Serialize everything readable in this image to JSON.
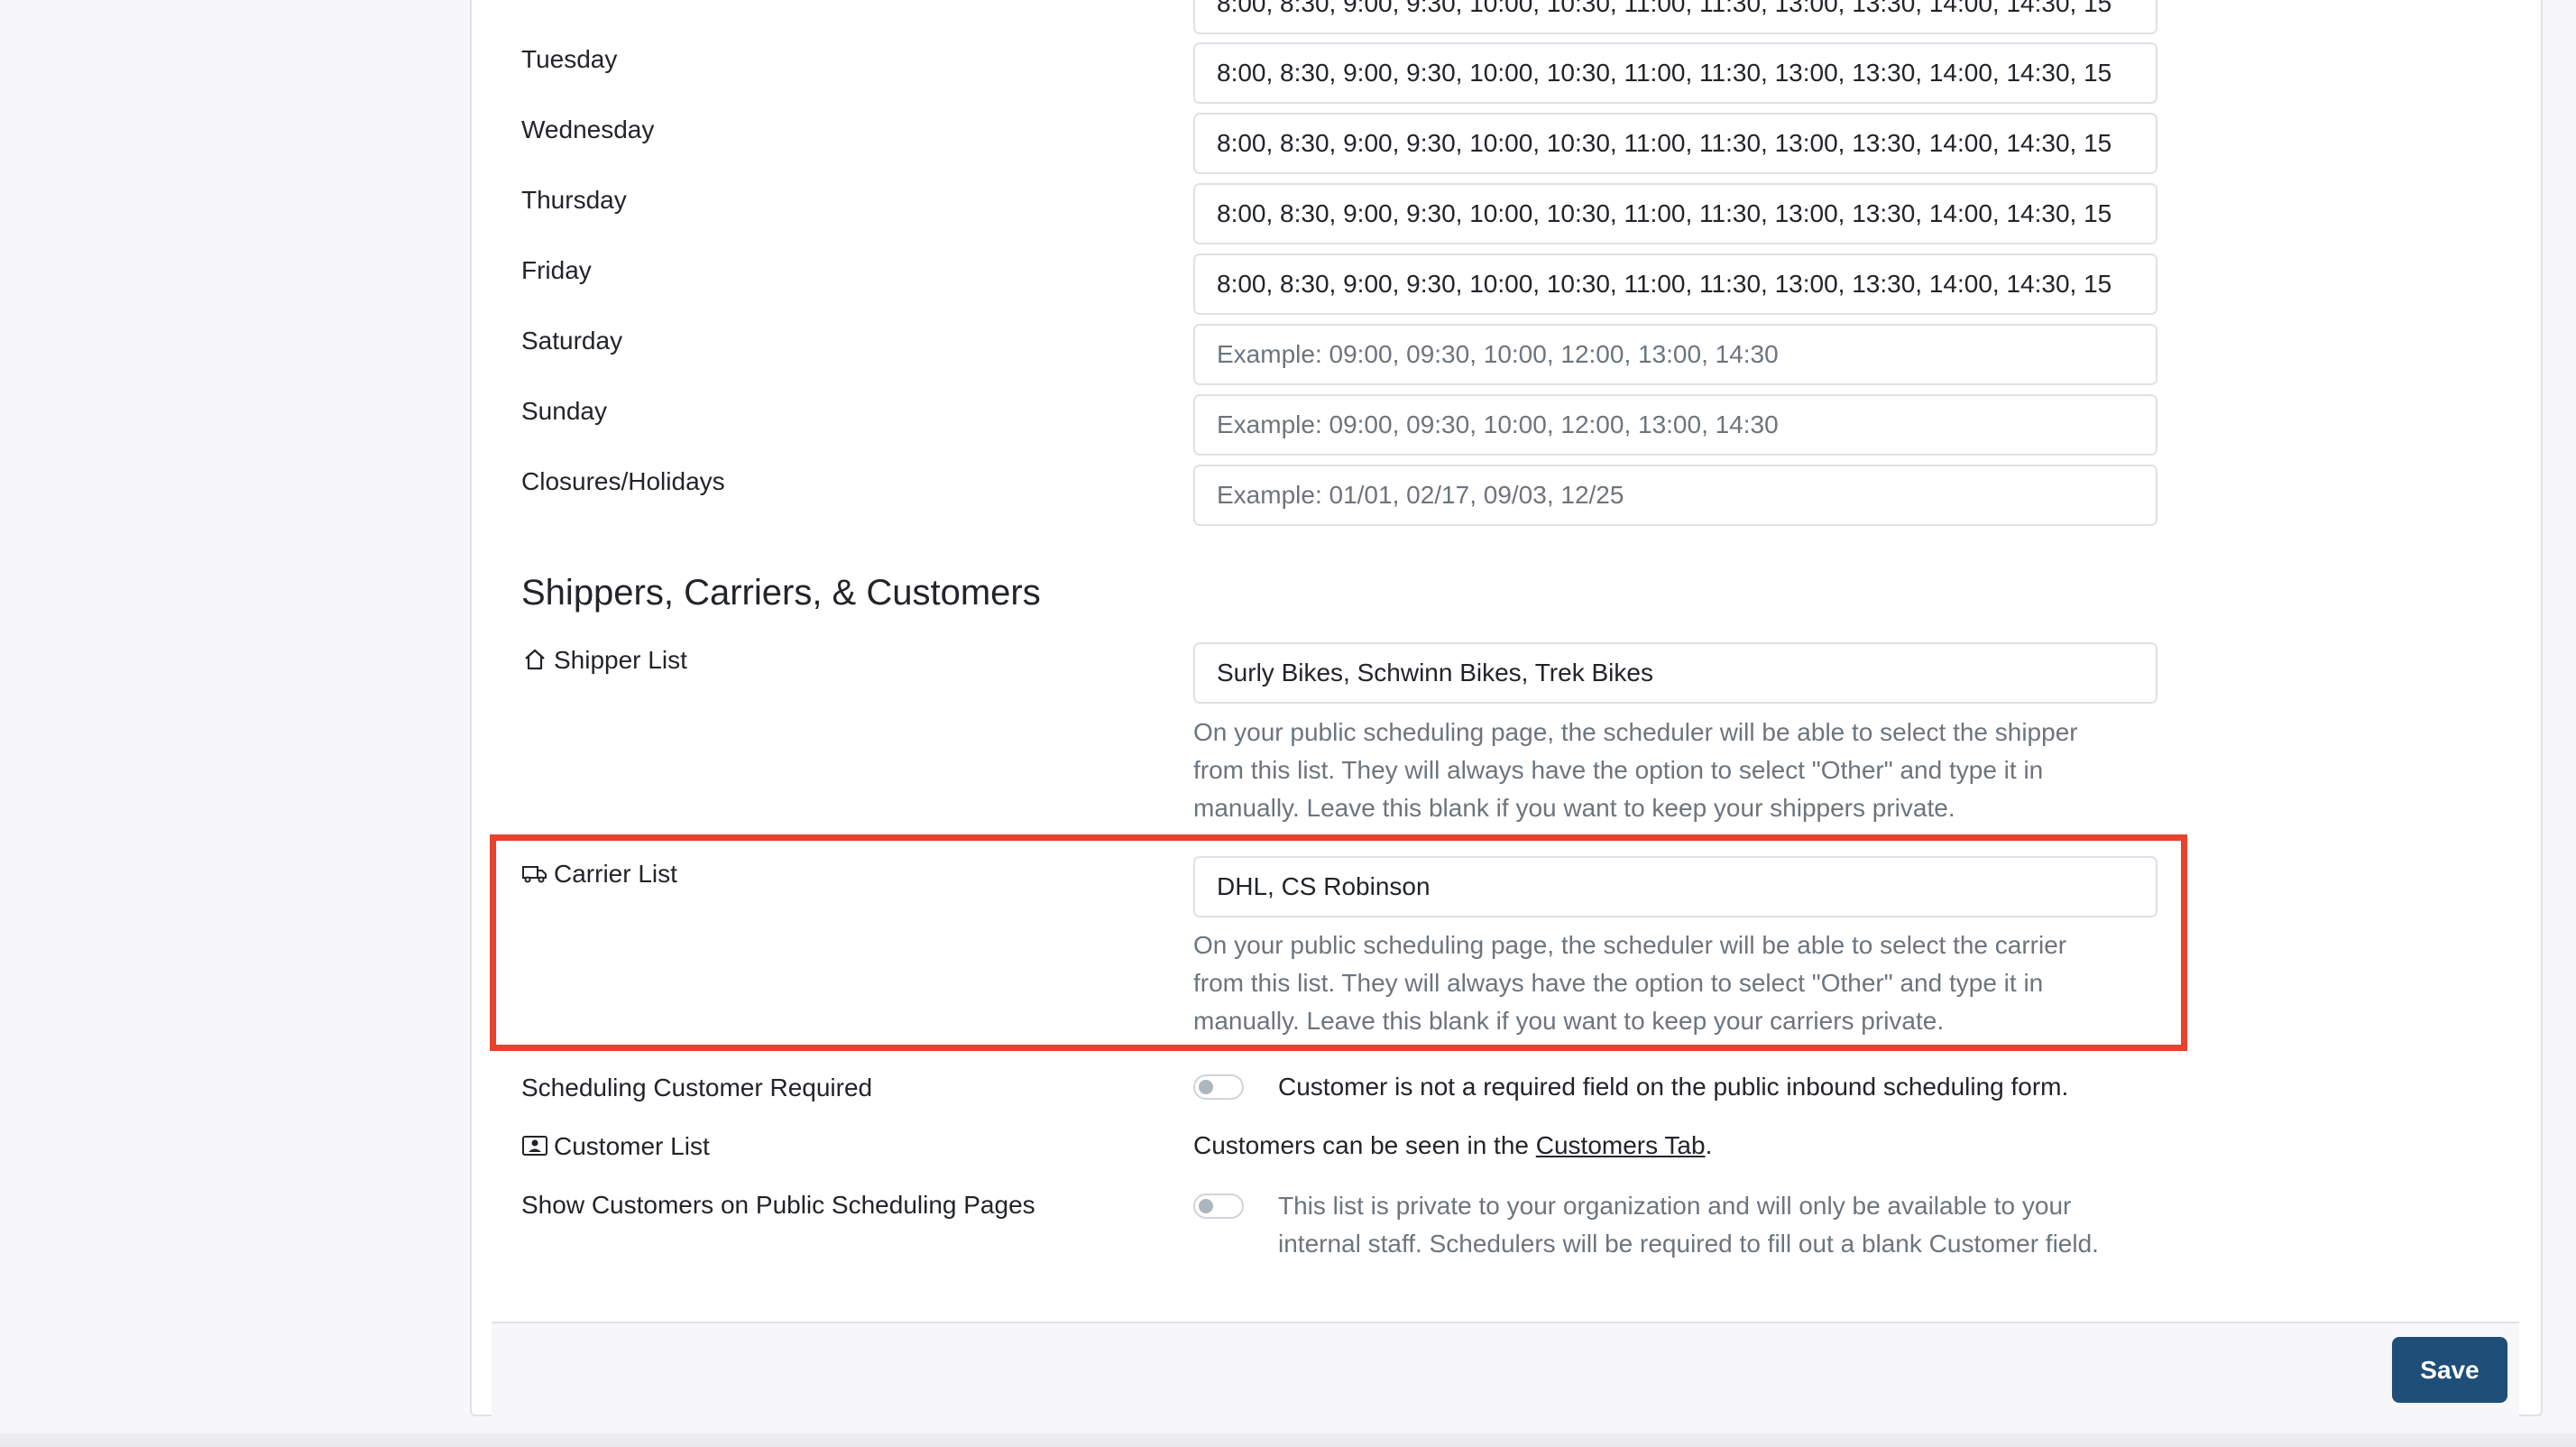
{
  "schedule": {
    "monday_value": "8:00, 8:30, 9:00, 9:30, 10:00, 10:30, 11:00, 11:30, 13:00, 13:30, 14:00, 14:30, 15",
    "rows": [
      {
        "label": "Tuesday",
        "value": "8:00, 8:30, 9:00, 9:30, 10:00, 10:30, 11:00, 11:30, 13:00, 13:30, 14:00, 14:30, 15",
        "placeholder": ""
      },
      {
        "label": "Wednesday",
        "value": "8:00, 8:30, 9:00, 9:30, 10:00, 10:30, 11:00, 11:30, 13:00, 13:30, 14:00, 14:30, 15",
        "placeholder": ""
      },
      {
        "label": "Thursday",
        "value": "8:00, 8:30, 9:00, 9:30, 10:00, 10:30, 11:00, 11:30, 13:00, 13:30, 14:00, 14:30, 15",
        "placeholder": ""
      },
      {
        "label": "Friday",
        "value": "8:00, 8:30, 9:00, 9:30, 10:00, 10:30, 11:00, 11:30, 13:00, 13:30, 14:00, 14:30, 15",
        "placeholder": ""
      },
      {
        "label": "Saturday",
        "value": "",
        "placeholder": "Example: 09:00, 09:30, 10:00, 12:00, 13:00, 14:30"
      },
      {
        "label": "Sunday",
        "value": "",
        "placeholder": "Example: 09:00, 09:30, 10:00, 12:00, 13:00, 14:30"
      },
      {
        "label": "Closures/Holidays",
        "value": "",
        "placeholder": "Example: 01/01, 02/17, 09/03, 12/25"
      }
    ]
  },
  "section": {
    "title": "Shippers, Carriers, & Customers"
  },
  "shipper": {
    "label": "Shipper List",
    "value": "Surly Bikes, Schwinn Bikes, Trek Bikes",
    "help": [
      "On your public scheduling page, the scheduler will be able to select the shipper",
      "from this list. They will always have the option to select \"Other\" and type it in",
      "manually. Leave this blank if you want to keep your shippers private."
    ]
  },
  "carrier": {
    "label": "Carrier List",
    "value": "DHL, CS Robinson",
    "help": [
      "On your public scheduling page, the scheduler will be able to select the carrier",
      "from this list. They will always have the option to select \"Other\" and type it in",
      "manually. Leave this blank if you want to keep your carriers private."
    ]
  },
  "customer_required": {
    "label": "Scheduling Customer Required",
    "toggle_on": false,
    "text": "Customer is not a required field on the public inbound scheduling form."
  },
  "customer_list": {
    "label": "Customer List",
    "text_before": "Customers can be seen in the ",
    "link_text": "Customers Tab",
    "text_after": "."
  },
  "show_customers": {
    "label": "Show Customers on Public Scheduling Pages",
    "toggle_on": false,
    "text": [
      "This list is private to your organization and will only be available to your",
      "internal staff. Schedulers will be required to fill out a blank Customer field."
    ]
  },
  "footer": {
    "save_label": "Save"
  },
  "colors": {
    "highlight": "#e8412c",
    "save_button": "#1f4e79"
  }
}
